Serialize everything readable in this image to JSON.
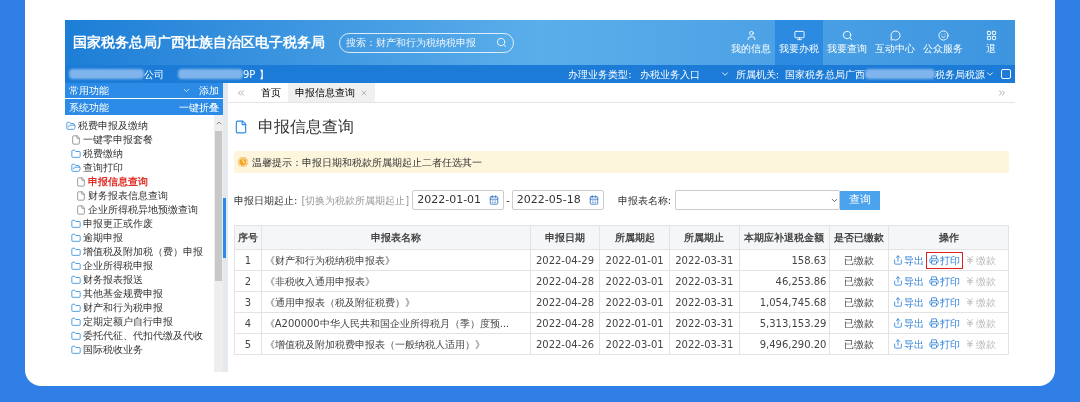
{
  "header": {
    "title": "国家税务总局广西壮族自治区电子税务局",
    "search_placeholder": "搜索：财产和行为税纳税申报",
    "nav": [
      {
        "label": "我的信息",
        "selected": false
      },
      {
        "label": "我要办税",
        "selected": true
      },
      {
        "label": "我要查询",
        "selected": false
      },
      {
        "label": "互动中心",
        "selected": false
      },
      {
        "label": "公众服务",
        "selected": false
      },
      {
        "label": "退",
        "selected": false
      }
    ]
  },
  "info_bar": {
    "company": "公司",
    "taxpayer_id": "9P 】",
    "business_type_label": "办理业务类型:",
    "business_type": "办税业务入口",
    "authority_label": "所属机关:",
    "authority_start": "国家税务总局广西",
    "authority_end": "税务局税源"
  },
  "sidebar": {
    "common": {
      "label": "常用功能",
      "action": "添加"
    },
    "system": {
      "label": "系统功能",
      "action": "一键折叠"
    },
    "tree": [
      {
        "label": "税费申报及缴纳",
        "expanded": true,
        "selected": false,
        "children": [
          {
            "label": "一键零申报套餐",
            "selected": false
          },
          {
            "label": "税费缴纳",
            "expanded": false,
            "selected": false
          },
          {
            "label": "查询打印",
            "expanded": true,
            "selected": false,
            "children": [
              {
                "label": "申报信息查询",
                "selected": true
              },
              {
                "label": "财务报表信息查询",
                "selected": false
              },
              {
                "label": "企业所得税异地预缴查询",
                "selected": false
              }
            ]
          },
          {
            "label": "申报更正或作废",
            "expanded": false,
            "selected": false
          },
          {
            "label": "逾期申报",
            "expanded": false,
            "selected": false
          },
          {
            "label": "增值税及附加税（费）申报",
            "expanded": false,
            "selected": false
          },
          {
            "label": "企业所得税申报",
            "expanded": false,
            "selected": false
          },
          {
            "label": "财务报表报送",
            "expanded": false,
            "selected": false
          },
          {
            "label": "其他基金规费申报",
            "expanded": false,
            "selected": false
          },
          {
            "label": "财产和行为税申报",
            "expanded": false,
            "selected": false
          },
          {
            "label": "定期定额户自行申报",
            "expanded": false,
            "selected": false
          },
          {
            "label": "委托代征、代扣代缴及代收",
            "expanded": false,
            "selected": false
          },
          {
            "label": "国际税收业务",
            "expanded": false,
            "selected": false
          }
        ]
      }
    ]
  },
  "tabs": [
    {
      "label": "首页",
      "selected": false,
      "closable": false
    },
    {
      "label": "申报信息查询",
      "selected": true,
      "closable": true
    }
  ],
  "page": {
    "title": "申报信息查询",
    "notice": "温馨提示：申报日期和税款所属期起止二者任选其一",
    "filter": {
      "date_label": "申报日期起止:",
      "switch_link": "[切换为税款所属期起止]",
      "date_from": "2022-01-01",
      "date_to": "2022-05-18",
      "separator": "-",
      "form_label": "申报表名称:",
      "query_button": "查询"
    },
    "table": {
      "columns": [
        "序号",
        "申报表名称",
        "申报日期",
        "所属期起",
        "所属期止",
        "本期应补退税金额",
        "是否已缴款",
        "操作"
      ],
      "rows": [
        {
          "cells": [
            "1",
            "《财产和行为税纳税申报表》",
            "2022-04-29",
            "2022-01-01",
            "2022-03-31",
            "158.63",
            "已缴款"
          ],
          "actions": [
            {
              "kind": "export",
              "label": "导出",
              "disabled": false,
              "highlighted": false
            },
            {
              "kind": "print",
              "label": "打印",
              "disabled": false,
              "highlighted": true
            },
            {
              "kind": "pay",
              "label": "缴款",
              "disabled": true,
              "highlighted": false
            }
          ]
        },
        {
          "cells": [
            "2",
            "《非税收入通用申报表》",
            "2022-04-28",
            "2022-03-01",
            "2022-03-31",
            "46,253.86",
            "已缴款"
          ],
          "actions": [
            {
              "kind": "export",
              "label": "导出",
              "disabled": false,
              "highlighted": false
            },
            {
              "kind": "print",
              "label": "打印",
              "disabled": false,
              "highlighted": false
            },
            {
              "kind": "pay",
              "label": "缴款",
              "disabled": true,
              "highlighted": false
            }
          ]
        },
        {
          "cells": [
            "3",
            "《通用申报表（税及附征税费）》",
            "2022-04-28",
            "2022-03-01",
            "2022-03-31",
            "1,054,745.68",
            "已缴款"
          ],
          "actions": [
            {
              "kind": "export",
              "label": "导出",
              "disabled": false,
              "highlighted": false
            },
            {
              "kind": "print",
              "label": "打印",
              "disabled": false,
              "highlighted": false
            },
            {
              "kind": "pay",
              "label": "缴款",
              "disabled": true,
              "highlighted": false
            }
          ]
        },
        {
          "cells": [
            "4",
            "《A200000中华人民共和国企业所得税月（季）度预...",
            "2022-04-28",
            "2022-01-01",
            "2022-03-31",
            "5,313,153.29",
            "已缴款"
          ],
          "actions": [
            {
              "kind": "export",
              "label": "导出",
              "disabled": false,
              "highlighted": false
            },
            {
              "kind": "print",
              "label": "打印",
              "disabled": false,
              "highlighted": false
            },
            {
              "kind": "pay",
              "label": "缴款",
              "disabled": true,
              "highlighted": false
            }
          ]
        },
        {
          "cells": [
            "5",
            "《增值税及附加税费申报表（一般纳税人适用）》",
            "2022-04-26",
            "2022-03-01",
            "2022-03-31",
            "9,496,290.20",
            "已缴款"
          ],
          "actions": [
            {
              "kind": "export",
              "label": "导出",
              "disabled": false,
              "highlighted": false
            },
            {
              "kind": "print",
              "label": "打印",
              "disabled": false,
              "highlighted": false
            },
            {
              "kind": "pay",
              "label": "缴款",
              "disabled": true,
              "highlighted": false
            }
          ]
        }
      ]
    }
  }
}
